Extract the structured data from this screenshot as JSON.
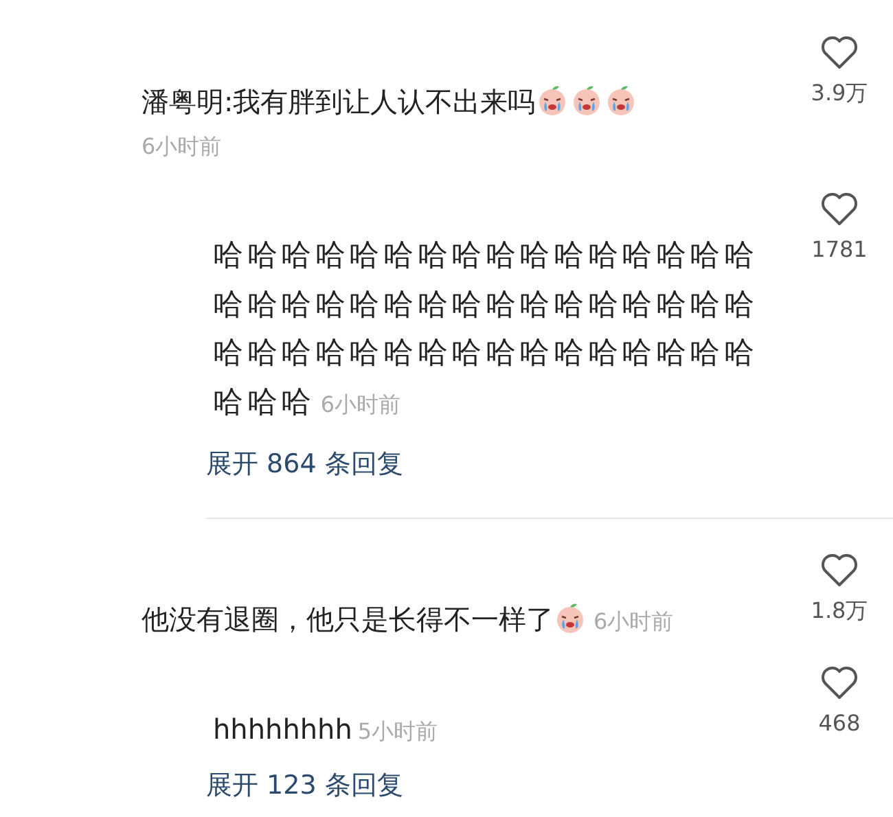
{
  "comments": [
    {
      "text": "潘粤明:我有胖到让人认不出来吗",
      "emojis": [
        {
          "kind": "crying"
        },
        {
          "kind": "crying"
        },
        {
          "kind": "crying"
        }
      ],
      "time": "6小时前",
      "time_inline": false,
      "likes": "3.9万",
      "replies": [
        {
          "text": "哈哈哈哈哈哈哈哈哈哈哈哈哈哈哈哈哈哈哈哈哈哈哈哈哈哈哈哈哈哈哈哈哈哈哈哈哈哈哈哈哈哈哈哈哈哈哈哈哈哈哈",
          "time": "6小时前",
          "likes": "1781"
        }
      ],
      "expand": "展开 864 条回复"
    },
    {
      "text": "他没有退圈，他只是长得不一样了",
      "emojis": [
        {
          "kind": "crying"
        }
      ],
      "time": "6小时前",
      "time_inline": true,
      "likes": "1.8万",
      "replies": [
        {
          "text": "hhhhhhhh",
          "time": "5小时前",
          "likes": "468"
        }
      ],
      "expand": "展开 123 条回复"
    }
  ]
}
